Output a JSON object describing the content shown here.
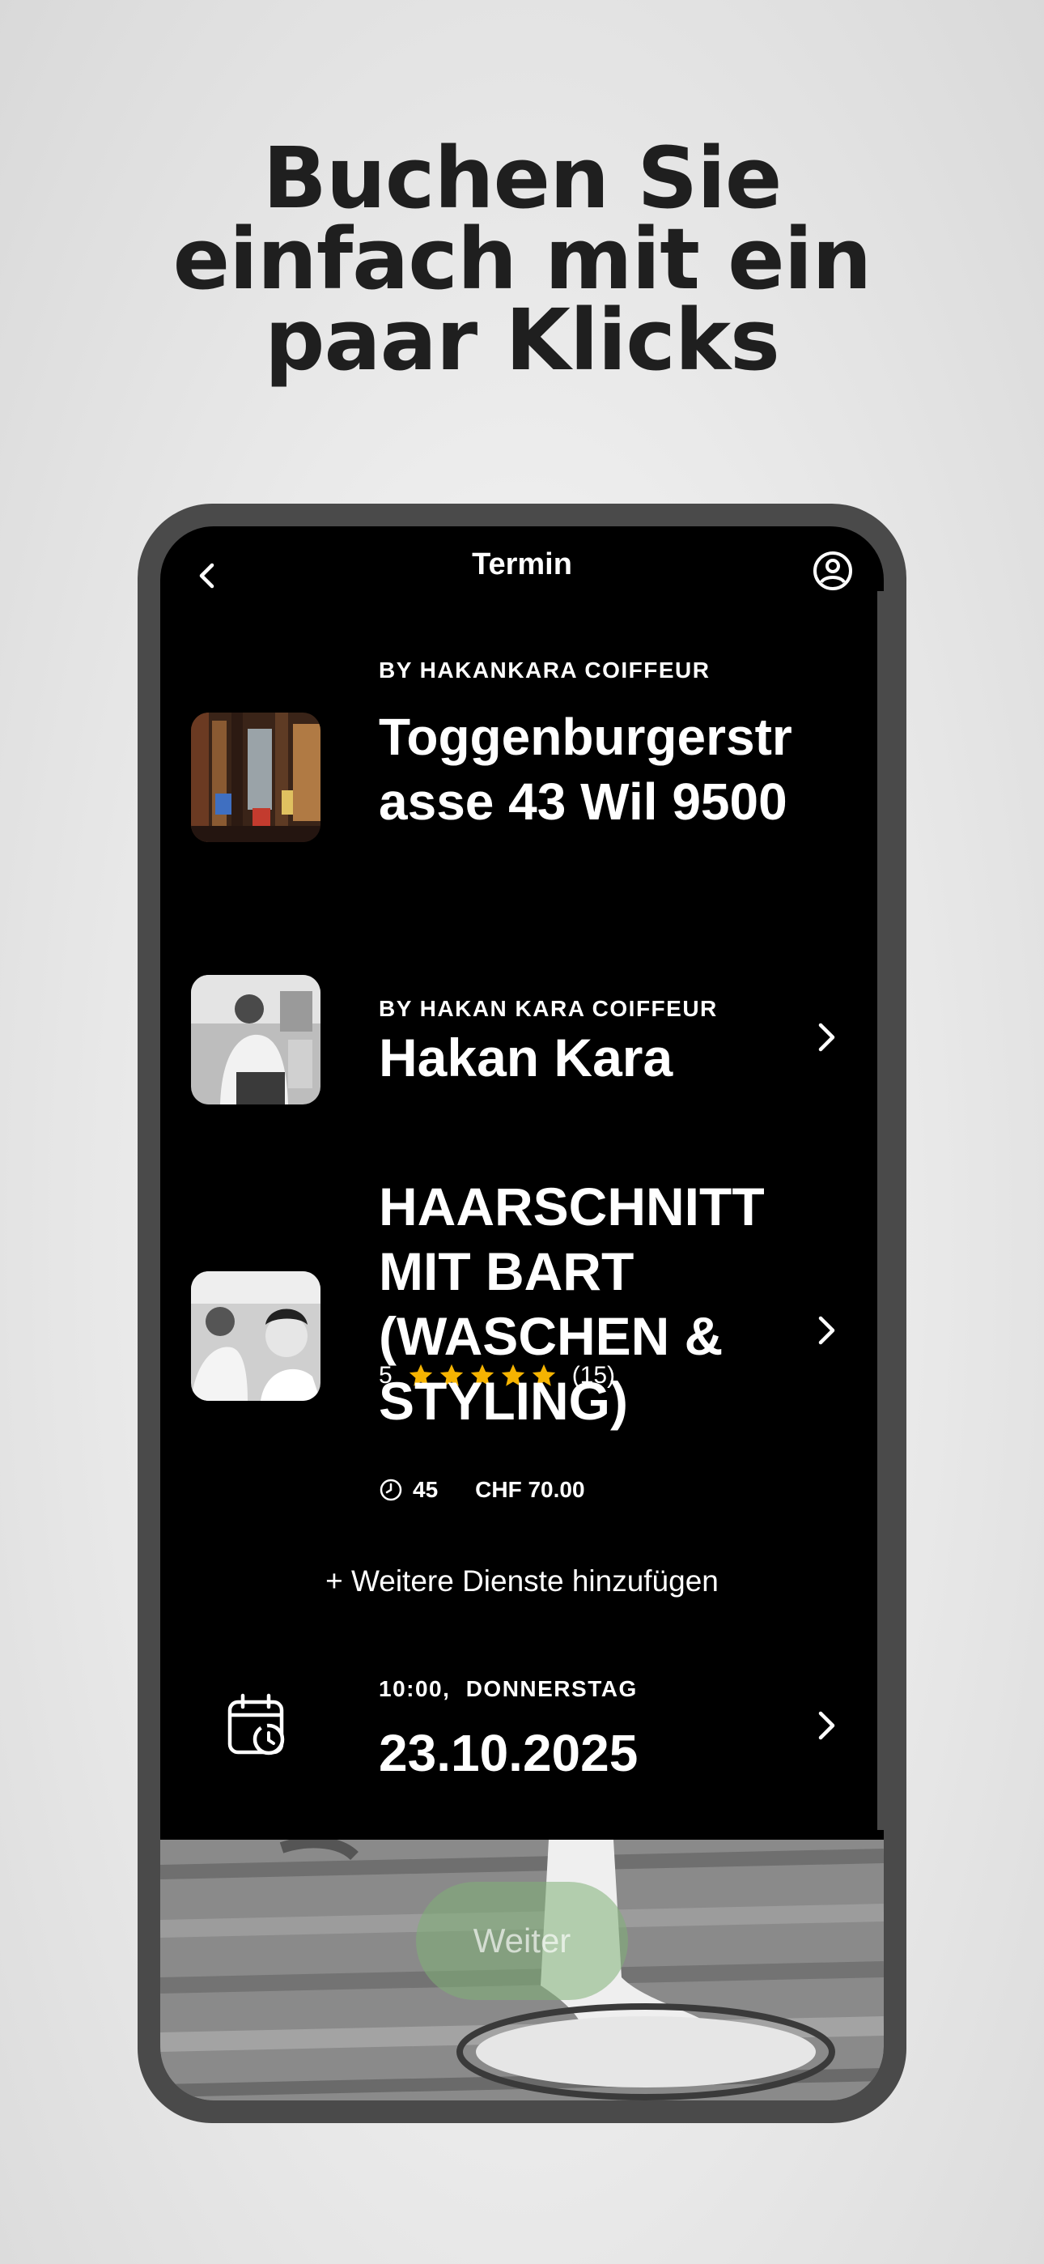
{
  "headline": {
    "line1": "Buchen Sie",
    "line2": "einfach mit ein",
    "line3": "paar Klicks"
  },
  "topbar": {
    "title": "Termin",
    "back_icon": "chevron-left-icon",
    "profile_icon": "user-circle-icon"
  },
  "location": {
    "eyebrow": "BY HAKANKARA COIFFEUR",
    "address_line1": "Toggenburgerstr",
    "address_line2": "asse 43 Wil 9500",
    "rating_value": "5",
    "rating_stars": 5,
    "rating_count": "(15)"
  },
  "stylist": {
    "eyebrow": "BY HAKAN KARA COIFFEUR",
    "name": "Hakan Kara"
  },
  "service": {
    "name_line1": "HAARSCHNITT",
    "name_line2": "MIT BART",
    "name_line3": "(WASCHEN &",
    "name_line4": "STYLING)",
    "duration": "45",
    "price": "CHF 70.00"
  },
  "add_more": "+ Weitere Dienste hinzufügen",
  "appointment": {
    "time": "10:00,",
    "weekday": "DONNERSTAG",
    "date": "23.10.2025"
  },
  "continue_button": "Weiter",
  "colors": {
    "star": "#f5b301",
    "button": "#80b076",
    "screen": "#000000",
    "frame": "#4a4a4a"
  }
}
